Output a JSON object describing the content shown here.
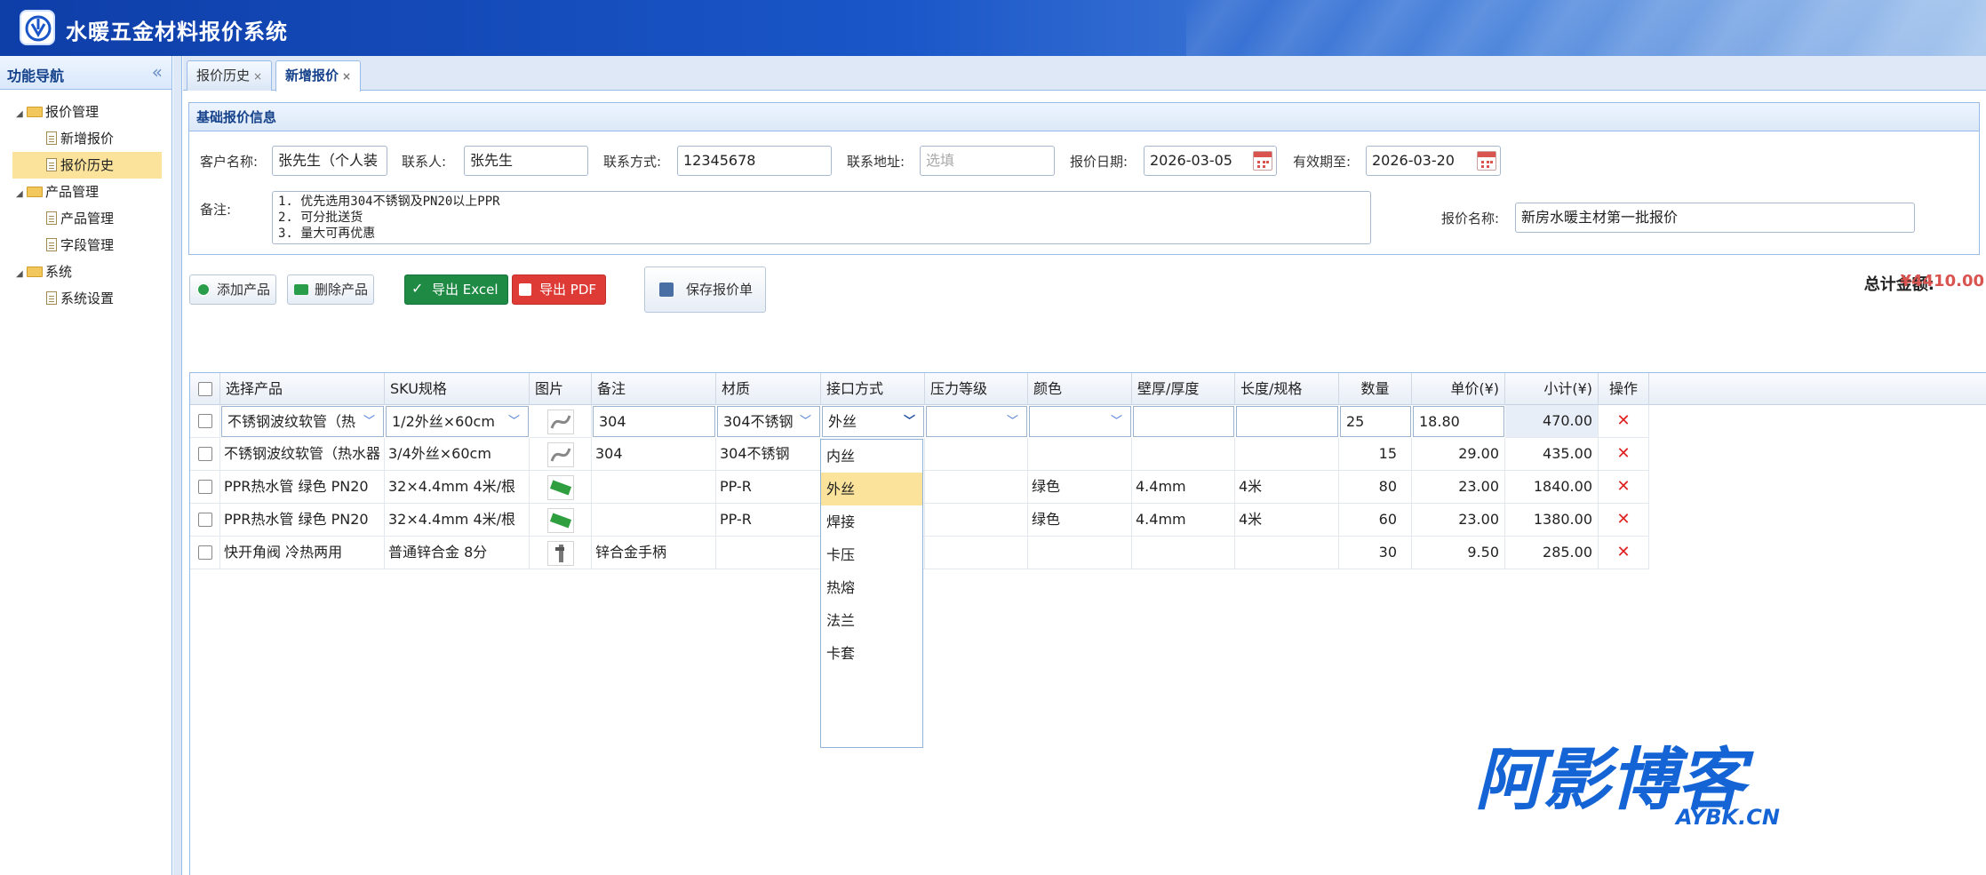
{
  "app": {
    "title": "水暖五金材料报价系统"
  },
  "sidebar": {
    "title": "功能导航",
    "collapse_icon": "double-chevron-left-icon",
    "groups": [
      {
        "label": "报价管理",
        "items": [
          {
            "label": "新增报价"
          },
          {
            "label": "报价历史",
            "selected": true
          }
        ]
      },
      {
        "label": "产品管理",
        "items": [
          {
            "label": "产品管理"
          },
          {
            "label": "字段管理"
          }
        ]
      },
      {
        "label": "系统",
        "items": [
          {
            "label": "系统设置"
          }
        ]
      }
    ]
  },
  "tabs": [
    {
      "label": "报价历史",
      "close": "×"
    },
    {
      "label": "新增报价",
      "close": "×",
      "active": true
    }
  ],
  "basic": {
    "title": "基础报价信息",
    "customer_label": "客户名称:",
    "customer_value": "张先生（个人装",
    "contact_label": "联系人:",
    "contact_value": "张先生",
    "phone_label": "联系方式:",
    "phone_value": "12345678",
    "address_label": "联系地址:",
    "address_placeholder": "选填",
    "date_label": "报价日期:",
    "date_value": "2026-03-05",
    "valid_label": "有效期至:",
    "valid_value": "2026-03-20",
    "memo_label": "备注:",
    "memo_lines": [
      "1. 优先选用304不锈钢及PN20以上PPR",
      "2. 可分批送货",
      "3. 量大可再优惠"
    ],
    "quote_name_label": "报价名称:",
    "quote_name_value": "新房水暖主材第一批报价"
  },
  "toolbar": {
    "add": "添加产品",
    "delete": "删除产品",
    "excel": "导出 Excel",
    "pdf": "导出 PDF",
    "save": "保存报价单",
    "total_label": "总计金额:",
    "total_value": "¥4410.00"
  },
  "grid": {
    "columns": [
      "选择产品",
      "SKU规格",
      "图片",
      "备注",
      "材质",
      "接口方式",
      "压力等级",
      "颜色",
      "壁厚/厚度",
      "长度/规格",
      "数量",
      "单价(¥)",
      "小计(¥)",
      "操作"
    ],
    "rows": [
      {
        "product": "不锈钢波纹软管（热",
        "sku": "1/2外丝×60cm",
        "note": "304",
        "material": "304不锈钢",
        "interface": "外丝",
        "pressure": "",
        "color": "",
        "thickness": "",
        "length": "",
        "qty": "25",
        "price": "18.80",
        "subtotal": "470.00",
        "action": "✕"
      },
      {
        "product": "不锈钢波纹软管（热水器",
        "sku": "3/4外丝×60cm",
        "note": "304",
        "material": "304不锈钢",
        "interface": "",
        "pressure": "",
        "color": "",
        "thickness": "",
        "length": "",
        "qty": "15",
        "price": "29.00",
        "subtotal": "435.00",
        "action": "✕"
      },
      {
        "product": "PPR热水管 绿色 PN20",
        "sku": "32×4.4mm 4米/根",
        "note": "",
        "material": "PP-R",
        "interface": "",
        "pressure": "",
        "color": "绿色",
        "thickness": "4.4mm",
        "length": "4米",
        "qty": "80",
        "price": "23.00",
        "subtotal": "1840.00",
        "action": "✕"
      },
      {
        "product": "PPR热水管 绿色 PN20",
        "sku": "32×4.4mm 4米/根",
        "note": "",
        "material": "PP-R",
        "interface": "",
        "pressure": "",
        "color": "绿色",
        "thickness": "4.4mm",
        "length": "4米",
        "qty": "60",
        "price": "23.00",
        "subtotal": "1380.00",
        "action": "✕"
      },
      {
        "product": "快开角阀 冷热两用",
        "sku": "普通锌合金 8分",
        "note": "锌合金手柄",
        "material": "",
        "interface": "",
        "pressure": "",
        "color": "",
        "thickness": "",
        "length": "",
        "qty": "30",
        "price": "9.50",
        "subtotal": "285.00",
        "action": "✕"
      }
    ]
  },
  "dropdown": {
    "options": [
      "内丝",
      "外丝",
      "焊接",
      "卡压",
      "热熔",
      "法兰",
      "卡套"
    ],
    "selected": "外丝"
  },
  "watermark": {
    "main": "阿影博客",
    "sub": "AYBK.CN"
  },
  "colors": {
    "header": "#1a56c8",
    "accent_red": "#d9534f",
    "excel_green": "#1e8a44",
    "pdf_red": "#de3b36",
    "highlight": "#fbe39b"
  }
}
